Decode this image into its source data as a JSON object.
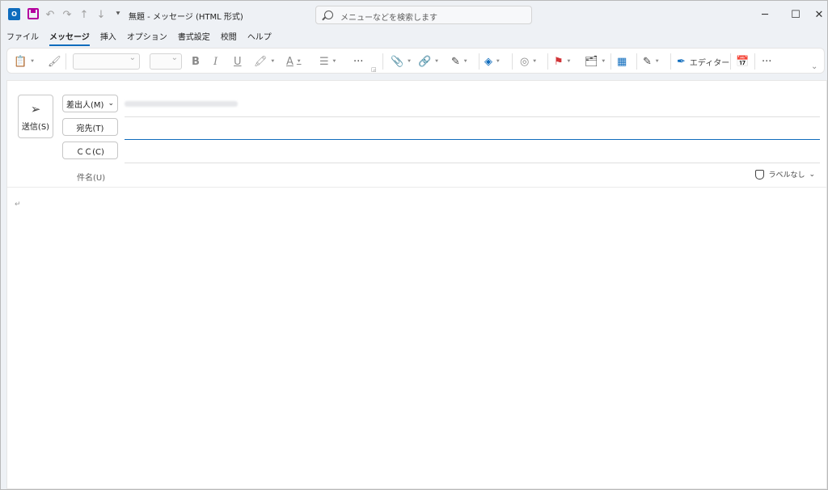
{
  "title": {
    "app_icon": "O",
    "text": "無題 - メッセージ (HTML 形式)"
  },
  "search": {
    "placeholder": "メニューなどを検索します"
  },
  "menu": [
    "ファイル",
    "メッセージ",
    "挿入",
    "オプション",
    "書式設定",
    "校閲",
    "ヘルプ"
  ],
  "menu_active": 1,
  "ribbon": {
    "editor_label": "エディター"
  },
  "compose": {
    "send_label": "送信(S)",
    "from_label": "差出人(M)",
    "to_label": "宛先(T)",
    "cc_label": "ＣＣ(C)",
    "subject_label": "件名(U)",
    "sensitivity_label": "ラベルなし"
  },
  "colors": {
    "accent": "#0f6cbd",
    "save": "#b4009e",
    "flag": "#d13438"
  }
}
